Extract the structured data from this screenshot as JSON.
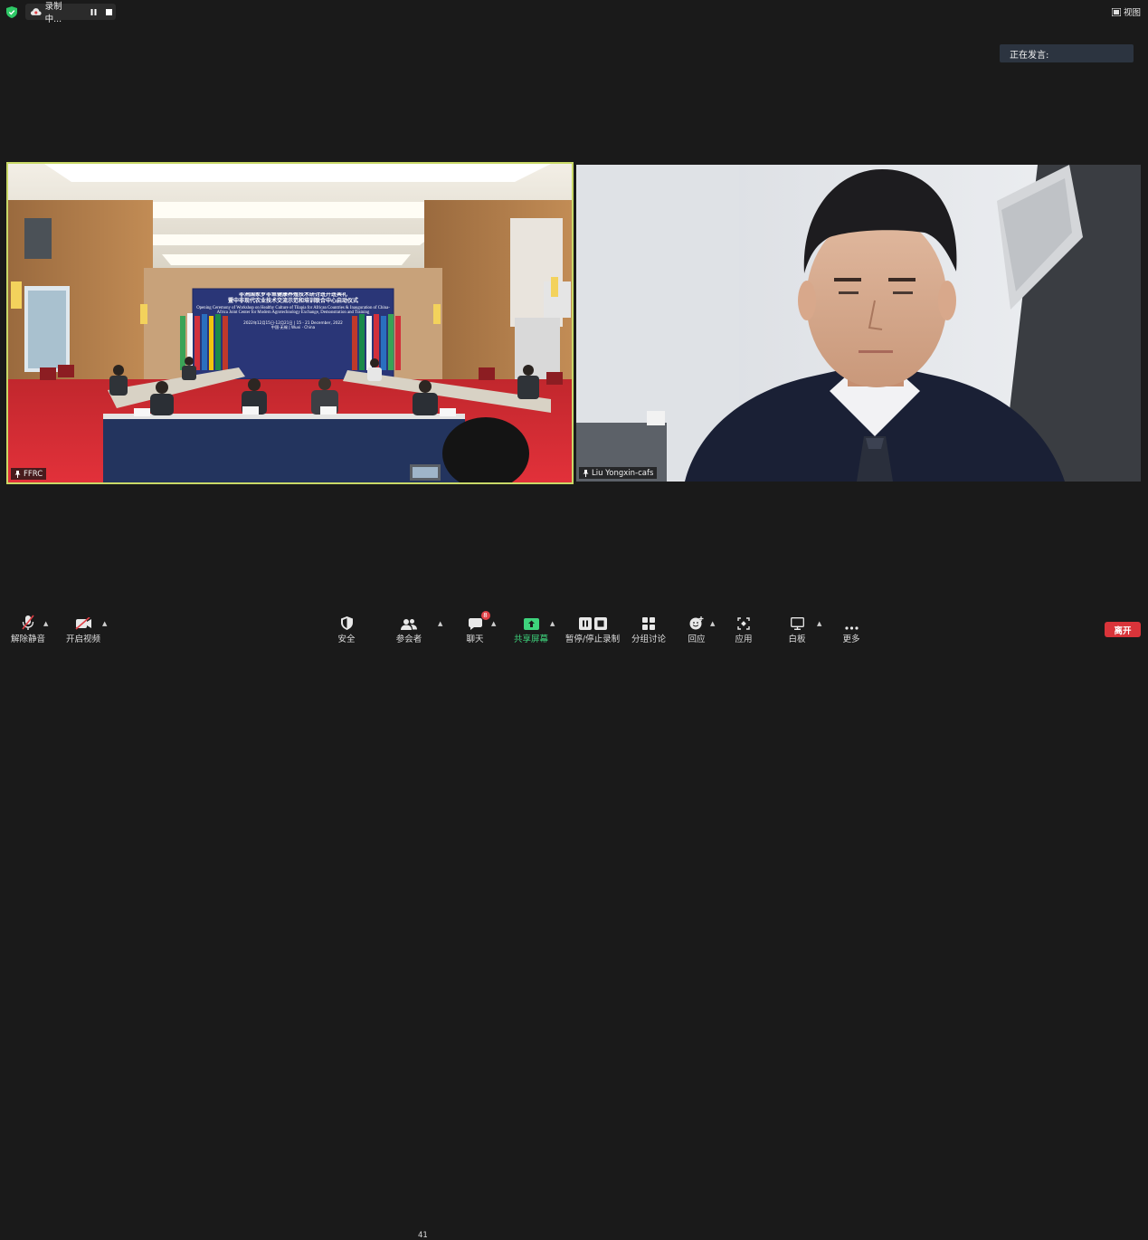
{
  "top_bar": {
    "recording_label": "录制中...",
    "view_label": "视图"
  },
  "speaking": {
    "label": "正在发言:"
  },
  "videos": [
    {
      "name": "FFRC"
    },
    {
      "name": "Liu Yongxin-cafs"
    }
  ],
  "banner": {
    "title_cn_1": "非洲国家罗非鱼健康养殖技术研讨班开班典礼",
    "title_cn_2": "暨中非现代农业技术交流示范和培训联合中心启动仪式",
    "title_en": "Opening Ceremony of Workshop on Healthy Culture of Tilapia for African Countries & Inauguration of China-Africa Joint Center for Modern Agrotechnology Exchange, Demonstration and Training",
    "date_line": "2022年12月15日-12月21日 | 15 - 21 December, 2022",
    "place_line": "中国·无锡 | Wuxi · China"
  },
  "toolbar": {
    "mute_label": "解除静音",
    "video_label": "开启视频",
    "security_label": "安全",
    "participants_label": "参会者",
    "participants_count": "41",
    "chat_label": "聊天",
    "chat_badge": "8",
    "share_label": "共享屏幕",
    "record_label": "暂停/停止录制",
    "breakout_label": "分组讨论",
    "reactions_label": "回应",
    "apps_label": "应用",
    "whiteboard_label": "白板",
    "more_label": "更多",
    "leave_label": "离开"
  },
  "colors": {
    "background": "#1a1a1a",
    "active_speaker_border": "#c9d967",
    "share_green": "#3ed37c",
    "leave_red": "#d9343a",
    "badge_red": "#e04046"
  }
}
